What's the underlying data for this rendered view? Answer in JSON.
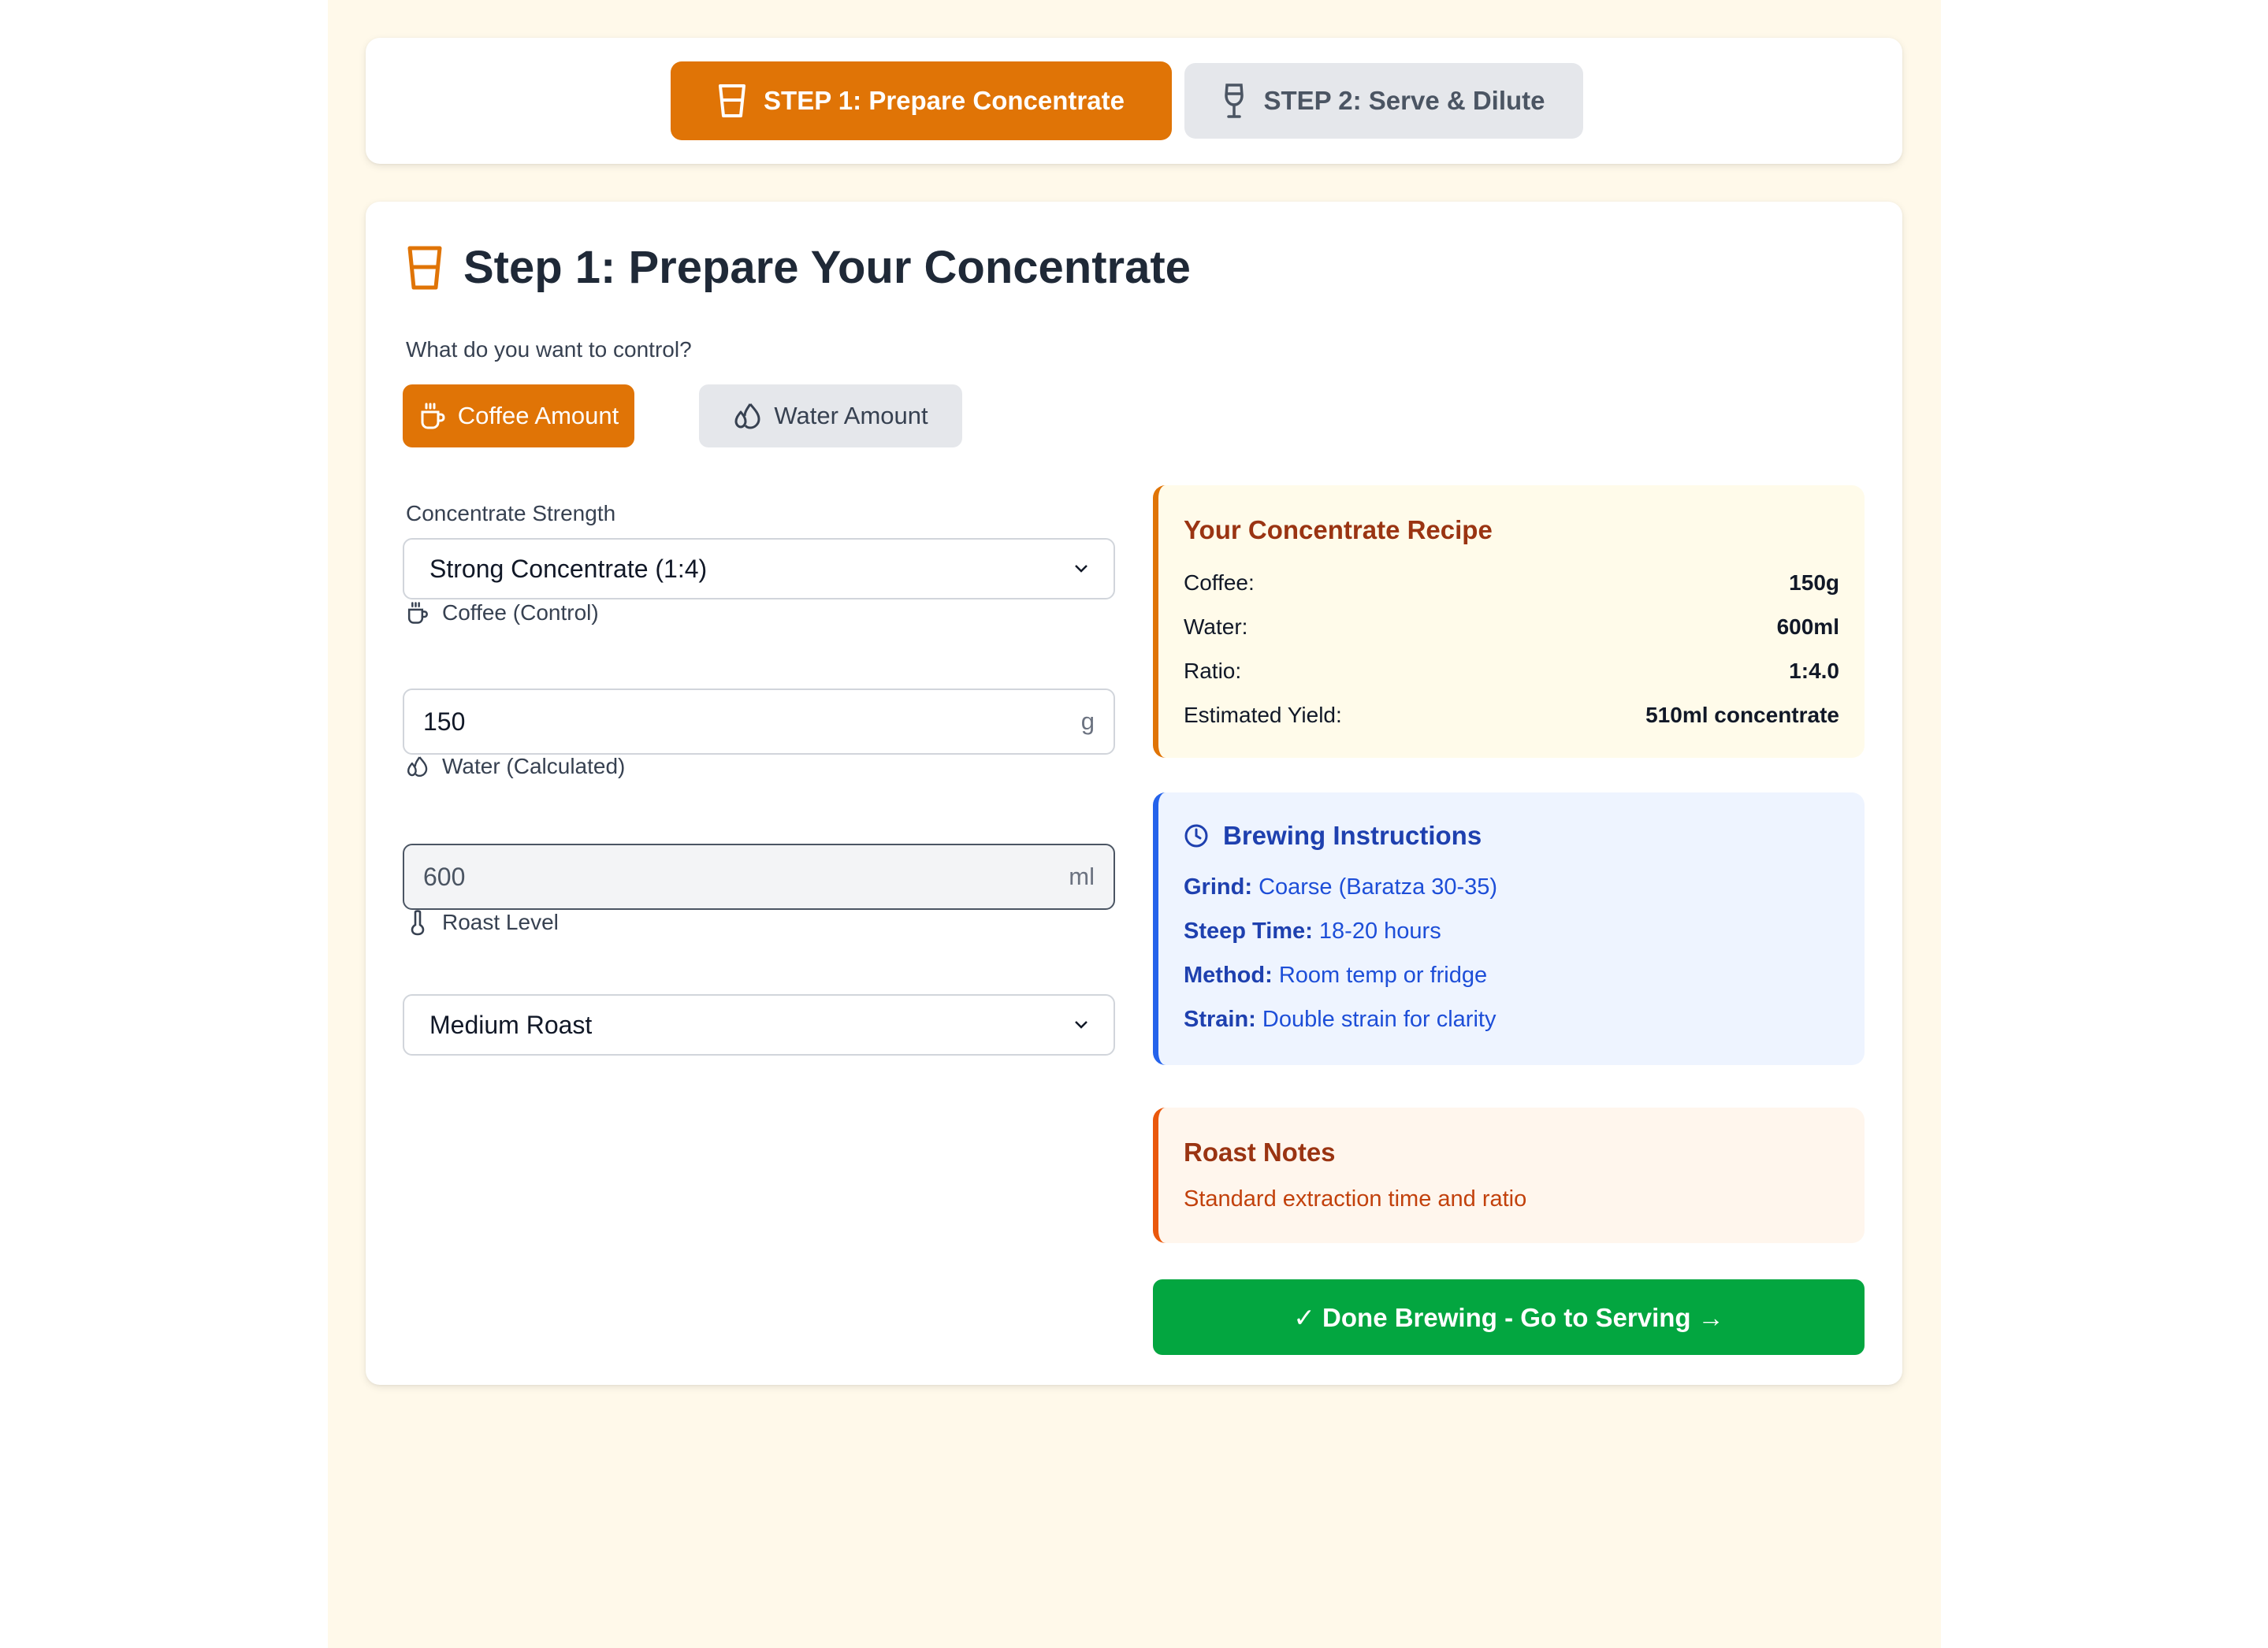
{
  "steps": {
    "step1_label": "STEP 1: Prepare Concentrate",
    "step2_label": "STEP 2: Serve & Dilute"
  },
  "main": {
    "title": "Step 1: Prepare Your Concentrate",
    "control_question": "What do you want to control?",
    "control_options": {
      "coffee": "Coffee Amount",
      "water": "Water Amount"
    },
    "strength_label": "Concentrate Strength",
    "strength_value": "Strong Concentrate (1:4)",
    "coffee_label": "Coffee (Control)",
    "coffee_value": "150",
    "coffee_unit": "g",
    "water_label": "Water (Calculated)",
    "water_value": "600",
    "water_unit": "ml",
    "roast_label": "Roast Level",
    "roast_value": "Medium Roast"
  },
  "recipe": {
    "title": "Your Concentrate Recipe",
    "rows": [
      {
        "k": "Coffee:",
        "v": "150g"
      },
      {
        "k": "Water:",
        "v": "600ml"
      },
      {
        "k": "Ratio:",
        "v": "1:4.0"
      },
      {
        "k": "Estimated Yield:",
        "v": "510ml concentrate"
      }
    ]
  },
  "brewing": {
    "title": "Brewing Instructions",
    "items": [
      {
        "k": "Grind:",
        "v": "Coarse (Baratza 30-35)"
      },
      {
        "k": "Steep Time:",
        "v": "18-20 hours"
      },
      {
        "k": "Method:",
        "v": "Room temp or fridge"
      },
      {
        "k": "Strain:",
        "v": "Double strain for clarity"
      }
    ]
  },
  "roast_notes": {
    "title": "Roast Notes",
    "text": "Standard extraction time and ratio"
  },
  "done_button": "✓ Done Brewing - Go to Serving →",
  "colors": {
    "accent_orange": "#e07406",
    "success_green": "#03a640",
    "info_blue": "#2563eb",
    "page_background": "#fff9ea"
  },
  "icons": {
    "step1": "glass-icon",
    "step2": "wine-glass-icon",
    "coffee": "coffee-cup-icon",
    "water": "droplets-icon",
    "roast": "thermometer-icon",
    "brewing": "clock-icon"
  }
}
